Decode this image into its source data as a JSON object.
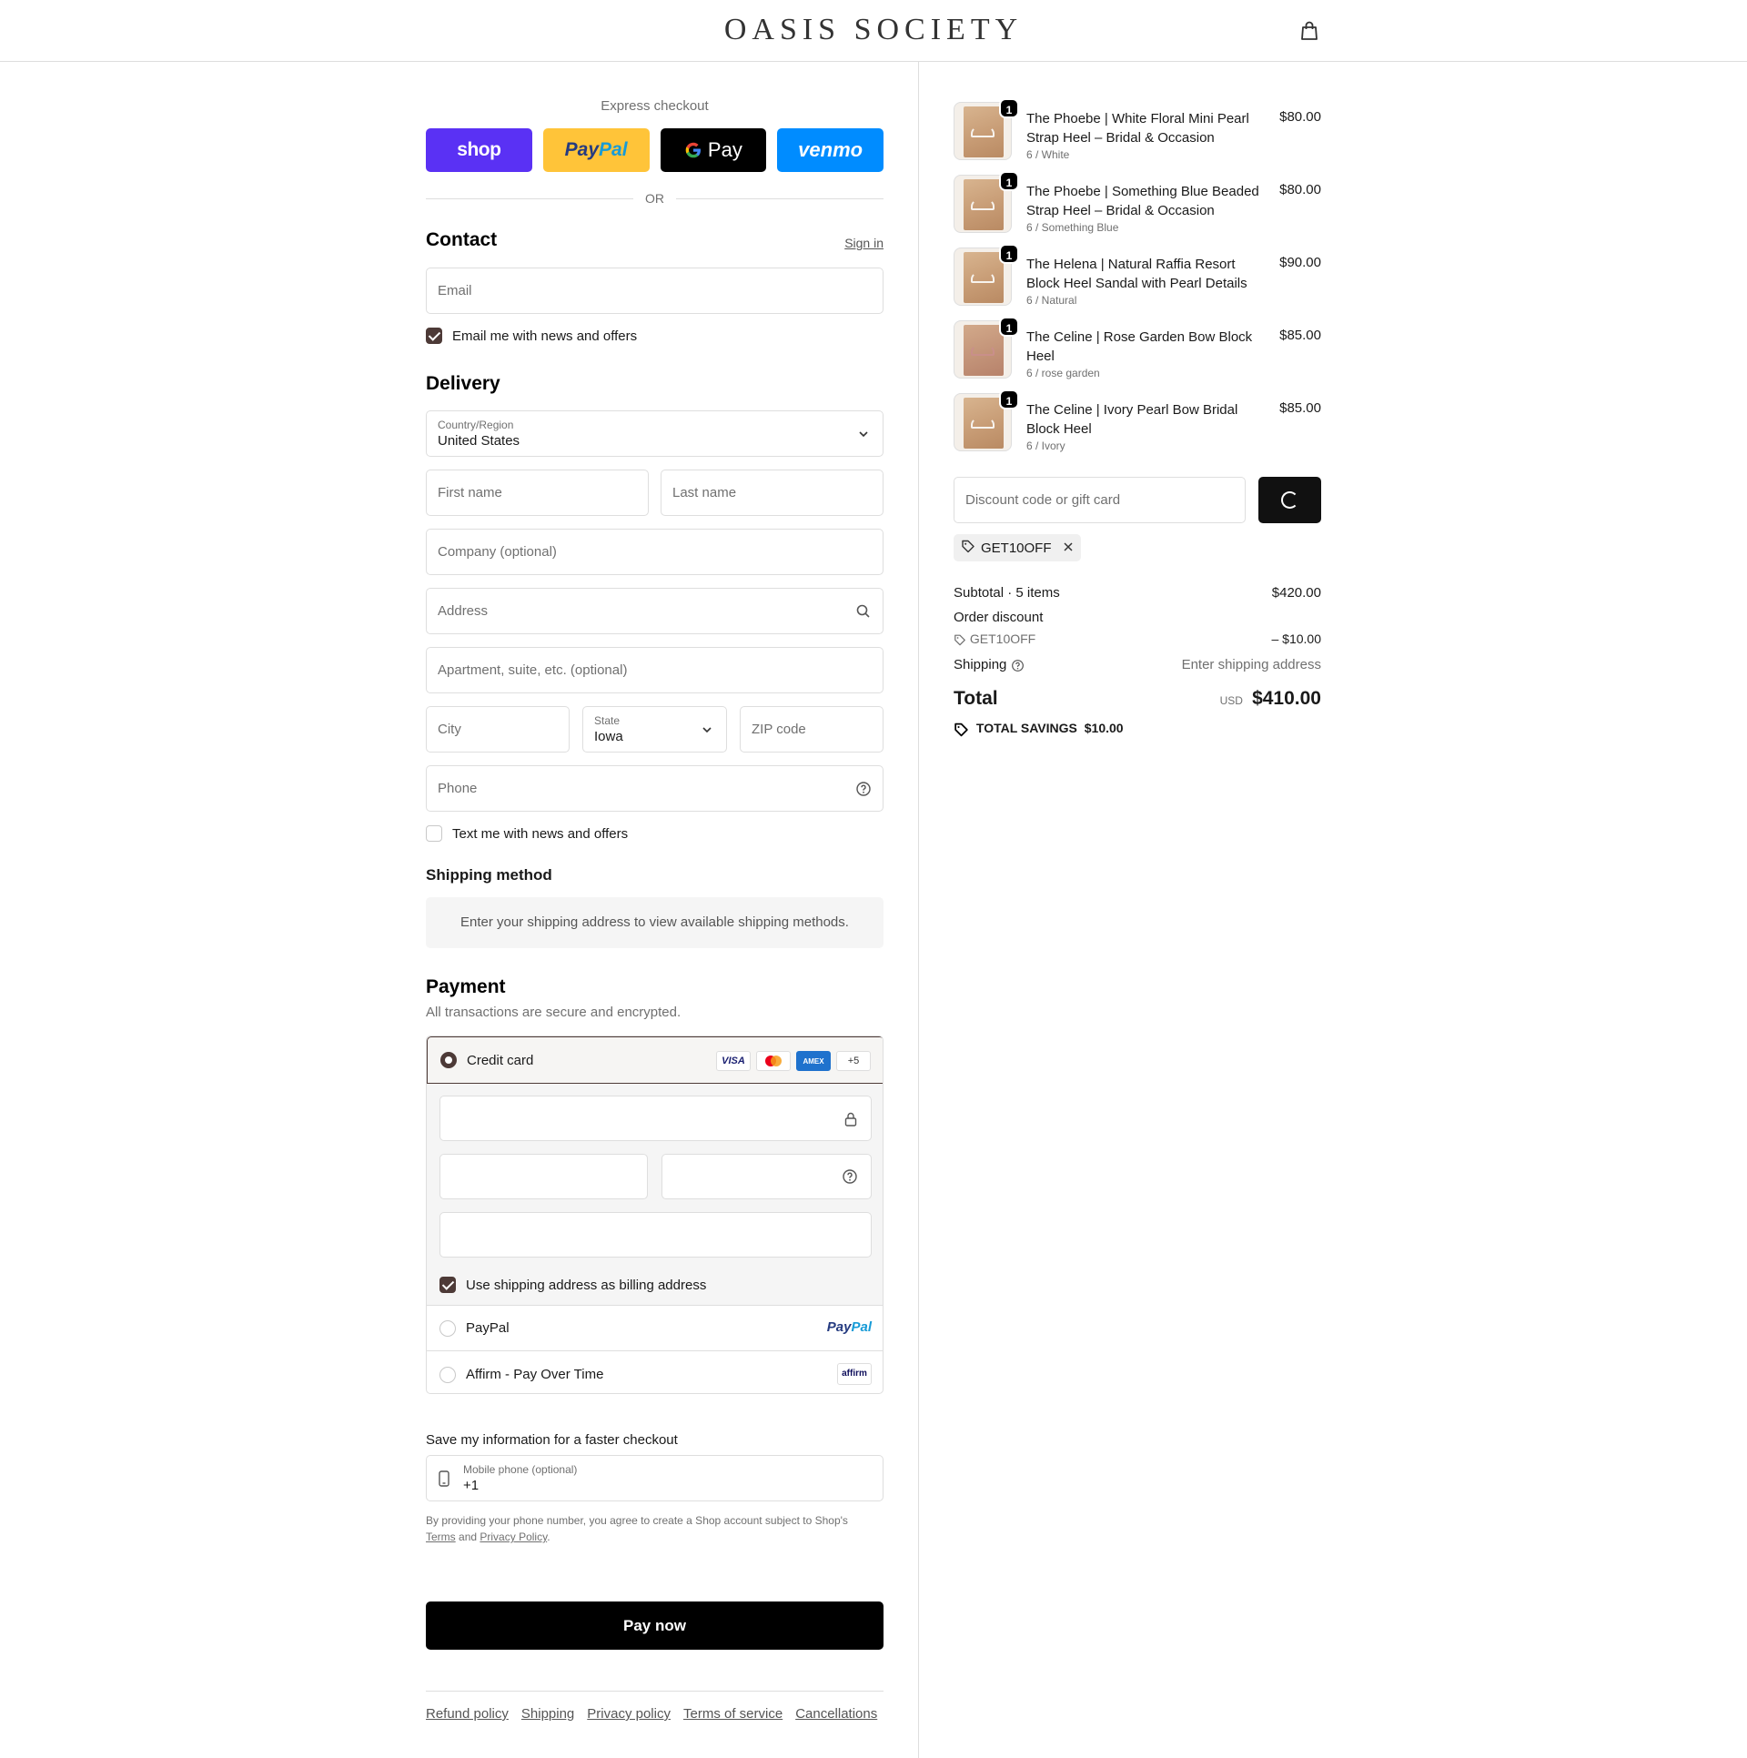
{
  "header": {
    "brand": "OASIS SOCIETY",
    "cart_icon": "shopping-bag-icon"
  },
  "express": {
    "title": "Express checkout",
    "shop": "shop",
    "paypal_a": "Pay",
    "paypal_b": "Pal",
    "gpay": "Pay",
    "venmo": "venmo",
    "or": "OR"
  },
  "contact": {
    "title": "Contact",
    "sign_in": "Sign in",
    "email_placeholder": "Email",
    "news_label": "Email me with news and offers",
    "news_checked": true
  },
  "delivery": {
    "title": "Delivery",
    "country_label": "Country/Region",
    "country_value": "United States",
    "first_name": "First name",
    "last_name": "Last name",
    "company": "Company (optional)",
    "address": "Address",
    "apartment": "Apartment, suite, etc. (optional)",
    "city": "City",
    "state_label": "State",
    "state_value": "Iowa",
    "zip": "ZIP code",
    "phone": "Phone",
    "text_label": "Text me with news and offers",
    "text_checked": false
  },
  "shipping_method": {
    "title": "Shipping method",
    "note": "Enter your shipping address to view available shipping methods."
  },
  "payment": {
    "title": "Payment",
    "subtitle": "All transactions are secure and encrypted.",
    "credit_card": "Credit card",
    "badges": [
      "VISA",
      "MC",
      "AMEX",
      "+5"
    ],
    "billing_label": "Use shipping address as billing address",
    "paypal": "PayPal",
    "paypal_logo_a": "Pay",
    "paypal_logo_b": "Pal",
    "affirm": "Affirm - Pay Over Time",
    "affirm_logo": "affirm"
  },
  "save_info": {
    "title": "Save my information for a faster checkout",
    "mobile_label": "Mobile phone (optional)",
    "mobile_value": "+1",
    "fine_1": "By providing your phone number, you agree to create a Shop account subject to Shop's",
    "terms": "Terms",
    "and": "and",
    "privacy": "Privacy Policy",
    "period": "."
  },
  "pay_now": "Pay now",
  "footer": [
    "Refund policy",
    "Shipping",
    "Privacy policy",
    "Terms of service",
    "Cancellations"
  ],
  "summary": {
    "items": [
      {
        "qty": "1",
        "name": "The Phoebe | White Floral Mini Pearl Strap Heel – Bridal & Occasion",
        "variant": "6 / White",
        "price": "$80.00"
      },
      {
        "qty": "1",
        "name": "The Phoebe | Something Blue Beaded Strap Heel – Bridal & Occasion",
        "variant": "6 / Something Blue",
        "price": "$80.00"
      },
      {
        "qty": "1",
        "name": "The Helena | Natural Raffia Resort Block Heel Sandal with Pearl Details",
        "variant": "6 / Natural",
        "price": "$90.00"
      },
      {
        "qty": "1",
        "name": "The Celine | Rose Garden Bow Block Heel",
        "variant": "6 / rose garden",
        "price": "$85.00"
      },
      {
        "qty": "1",
        "name": "The Celine | Ivory Pearl Bow Bridal Block Heel",
        "variant": "6 / Ivory",
        "price": "$85.00"
      }
    ],
    "discount_placeholder": "Discount code or gift card",
    "code": "GET10OFF",
    "subtotal_label": "Subtotal · 5 items",
    "subtotal_value": "$420.00",
    "order_discount_label": "Order discount",
    "discount_code": "GET10OFF",
    "discount_value": "– $10.00",
    "shipping_label": "Shipping",
    "shipping_value": "Enter shipping address",
    "total_label": "Total",
    "currency": "USD",
    "total_value": "$410.00",
    "savings_label": "TOTAL SAVINGS",
    "savings_value": "$10.00"
  }
}
